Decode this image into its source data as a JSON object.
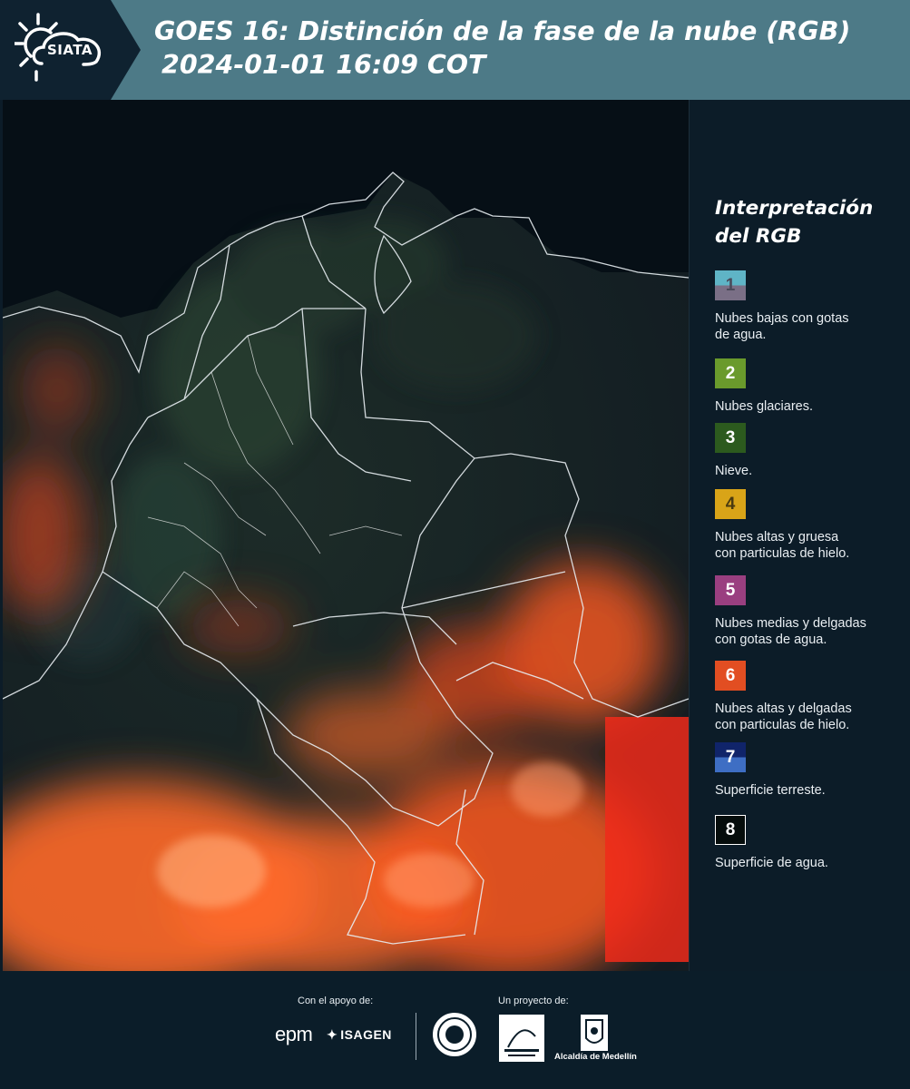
{
  "header": {
    "logo_text": "SIATA",
    "title_line1": "GOES 16: Distinción de la fase de la nube (RGB)",
    "title_line2": "2024-01-01 16:09 COT",
    "background_color": "#4d7a87"
  },
  "legend": {
    "title_line1": "Interpretación",
    "title_line2": "del RGB",
    "items": [
      {
        "number": "1",
        "label_line1": "Nubes bajas con gotas",
        "label_line2": "de agua.",
        "color_top": "#5fb4c6",
        "color_bottom": "#7a6f86",
        "text_color": "#4a4a5a"
      },
      {
        "number": "2",
        "label_line1": "Nubes glaciares.",
        "label_line2": "",
        "color_top": "#6a9a2c",
        "color_bottom": "#6a9a2c",
        "text_color": "#ffffff"
      },
      {
        "number": "3",
        "label_line1": "Nieve.",
        "label_line2": "",
        "color_top": "#2c5a1e",
        "color_bottom": "#2c5a1e",
        "text_color": "#ffffff"
      },
      {
        "number": "4",
        "label_line1": "Nubes altas y gruesa",
        "label_line2": "con particulas de hielo.",
        "color_top": "#d9a418",
        "color_bottom": "#d9a418",
        "text_color": "#4a3a10"
      },
      {
        "number": "5",
        "label_line1": "Nubes medias y delgadas",
        "label_line2": "con gotas de agua.",
        "color_top": "#9a3f80",
        "color_bottom": "#9a3f80",
        "text_color": "#ffffff"
      },
      {
        "number": "6",
        "label_line1": "Nubes altas y delgadas",
        "label_line2": "con particulas de hielo.",
        "color_top": "#e24e22",
        "color_bottom": "#e24e22",
        "text_color": "#ffffff"
      },
      {
        "number": "7",
        "label_line1": "Superficie terreste.",
        "label_line2": "",
        "color_top": "#10246a",
        "color_bottom": "#3e6ec4",
        "text_color": "#ffffff"
      },
      {
        "number": "8",
        "label_line1": "Superficie de agua.",
        "label_line2": "",
        "color_top": "#060d0c",
        "color_bottom": "#060d0c",
        "text_color": "#ffffff"
      }
    ]
  },
  "footer": {
    "support_label": "Con el apoyo de:",
    "project_label": "Un proyecto de:",
    "epm_text": "epm",
    "isagen_text": "ISAGEN",
    "alcaldia_text": "Alcaldía de Medellín"
  }
}
